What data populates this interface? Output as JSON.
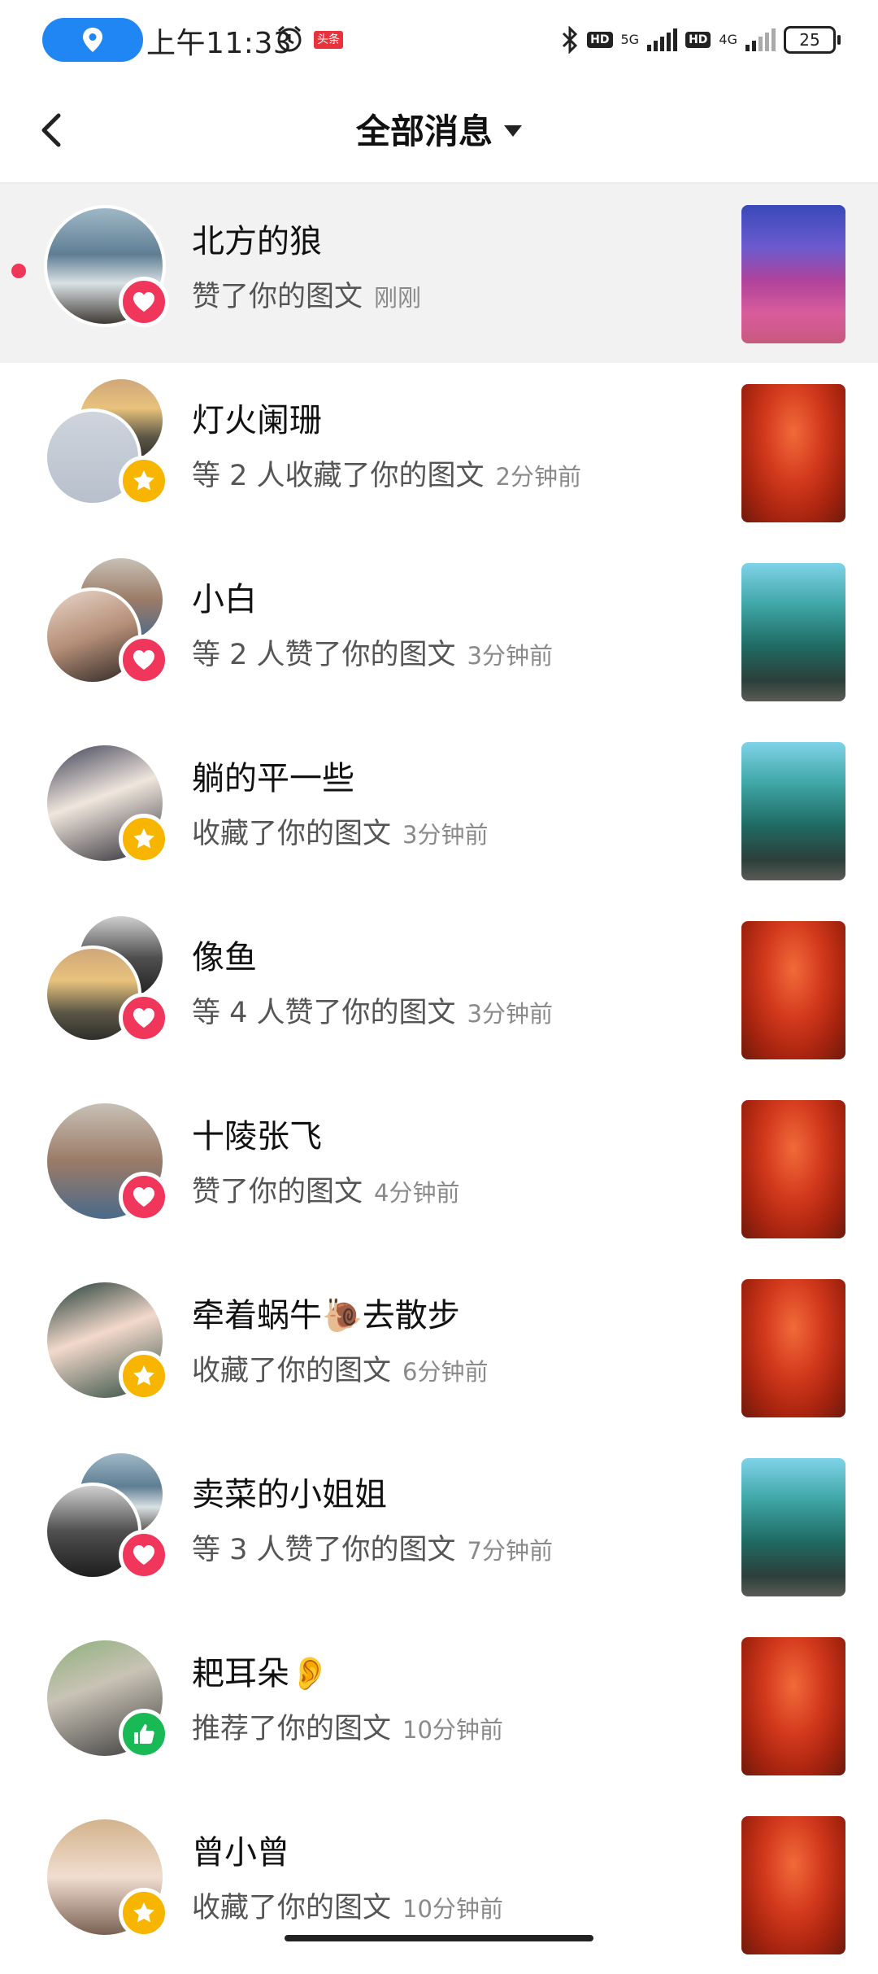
{
  "status_bar": {
    "time": "上午11:33",
    "toutiao": "头条",
    "hd1": "HD",
    "net1": "5G",
    "hd2": "HD",
    "net2": "4G",
    "battery": "25"
  },
  "header": {
    "title": "全部消息"
  },
  "messages": [
    {
      "name": "北方的狼",
      "action": "赞了你的图文",
      "time": "刚刚",
      "badge": "like",
      "unread": true,
      "thumb": "pink"
    },
    {
      "name": "灯火阑珊",
      "action": "等 2 人收藏了你的图文",
      "time": "2分钟前",
      "badge": "fav",
      "unread": false,
      "thumb": "red"
    },
    {
      "name": "小白",
      "action": "等 2 人赞了你的图文",
      "time": "3分钟前",
      "badge": "like",
      "unread": false,
      "thumb": "green"
    },
    {
      "name": "躺的平一些",
      "action": "收藏了你的图文",
      "time": "3分钟前",
      "badge": "fav",
      "unread": false,
      "thumb": "green"
    },
    {
      "name": "像鱼",
      "action": "等 4 人赞了你的图文",
      "time": "3分钟前",
      "badge": "like",
      "unread": false,
      "thumb": "red"
    },
    {
      "name": "十陵张飞",
      "action": "赞了你的图文",
      "time": "4分钟前",
      "badge": "like",
      "unread": false,
      "thumb": "red"
    },
    {
      "name": "牵着蜗牛🐌去散步",
      "action": "收藏了你的图文",
      "time": "6分钟前",
      "badge": "fav",
      "unread": false,
      "thumb": "red"
    },
    {
      "name": "卖菜的小姐姐",
      "action": "等 3 人赞了你的图文",
      "time": "7分钟前",
      "badge": "like",
      "unread": false,
      "thumb": "green"
    },
    {
      "name": "耙耳朵👂",
      "action": "推荐了你的图文",
      "time": "10分钟前",
      "badge": "thumb",
      "unread": false,
      "thumb": "red"
    },
    {
      "name": "曾小曾",
      "action": "收藏了你的图文",
      "time": "10分钟前",
      "badge": "fav",
      "unread": false,
      "thumb": "red"
    }
  ],
  "colors": {
    "like": "#f0365b",
    "favorite": "#f7b500",
    "recommend": "#19b955",
    "location_pill": "#1f86f3"
  }
}
